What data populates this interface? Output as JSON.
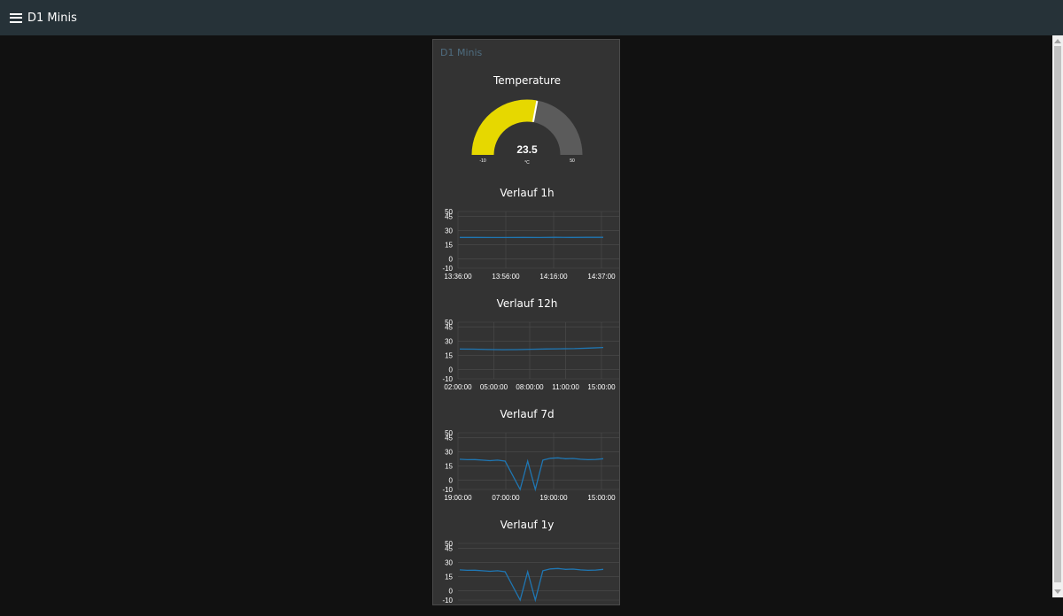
{
  "app": {
    "title": "D1 Minis"
  },
  "group": {
    "title": "D1 Minis"
  },
  "gauge": {
    "title": "Temperature",
    "value": "23.5",
    "numeric_value": 23.5,
    "unit": "°C",
    "min_label": "-10",
    "max_label": "50",
    "min": -10,
    "max": 50,
    "fill_color": "#e6d800",
    "track_color": "#5b5b5b"
  },
  "chart_data": [
    {
      "type": "line",
      "title": "Verlauf 1h",
      "y_ticks": [
        "50",
        "45",
        "30",
        "15",
        "0",
        "-10"
      ],
      "x_ticks": [
        "13:36:00",
        "13:56:00",
        "14:16:00",
        "14:37:00"
      ],
      "ylim": [
        -10,
        50
      ],
      "series": [
        {
          "values": [
            22.5,
            22.5,
            22.4,
            22.4,
            22.5,
            22.4,
            22.6,
            22.5,
            22.6,
            22.6
          ]
        }
      ]
    },
    {
      "type": "line",
      "title": "Verlauf 12h",
      "y_ticks": [
        "50",
        "45",
        "30",
        "15",
        "0",
        "-10"
      ],
      "x_ticks": [
        "02:00:00",
        "05:00:00",
        "08:00:00",
        "11:00:00",
        "15:00:00"
      ],
      "ylim": [
        -10,
        50
      ],
      "series": [
        {
          "values": [
            21.5,
            21.4,
            21.0,
            20.8,
            20.9,
            21.3,
            21.6,
            21.8,
            22.0,
            22.5,
            23.2
          ]
        }
      ]
    },
    {
      "type": "line",
      "title": "Verlauf 7d",
      "y_ticks": [
        "50",
        "45",
        "30",
        "15",
        "0",
        "-10"
      ],
      "x_ticks": [
        "19:00:00",
        "07:00:00",
        "19:00:00",
        "15:00:00"
      ],
      "ylim": [
        -10,
        50
      ],
      "series": [
        {
          "values": [
            22,
            21.5,
            21.6,
            21,
            20.5,
            21,
            20,
            5,
            -10,
            20,
            -10,
            21,
            23,
            23.5,
            22.5,
            22.8,
            22,
            21.5,
            21.8,
            22.5
          ]
        }
      ]
    },
    {
      "type": "line",
      "title": "Verlauf 1y",
      "y_ticks": [
        "50",
        "45",
        "30",
        "15",
        "0",
        "-10"
      ],
      "x_ticks": [],
      "ylim": [
        -10,
        50
      ],
      "series": [
        {
          "values": [
            22,
            21.5,
            21.6,
            21,
            20.5,
            21,
            20,
            5,
            -10,
            20,
            -10,
            21,
            23,
            23.5,
            22.5,
            22.8,
            22,
            21.5,
            21.8,
            22.5
          ]
        }
      ]
    }
  ],
  "colors": {
    "line": "#1f77b4",
    "grid": "#4d4d4d",
    "axis_text": "#ffffff",
    "header_bg": "#263238",
    "group_title": "#4f6d80"
  }
}
